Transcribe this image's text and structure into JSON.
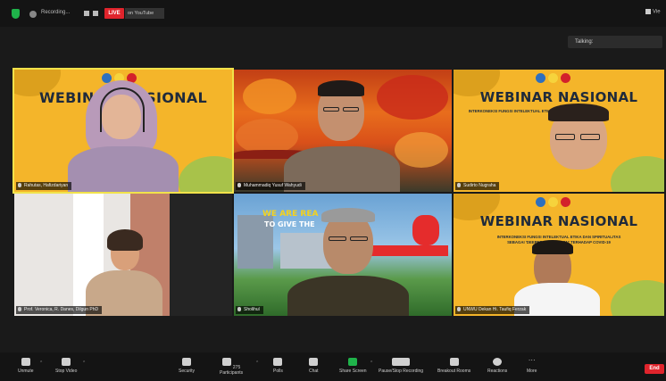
{
  "topbar": {
    "recording_text": "Recording...",
    "live_label": "LIVE",
    "live_destination": "on YouTube",
    "view_label": "Vie"
  },
  "talking_label": "Talking:",
  "banner": {
    "title": "WEBINAR NASIONAL",
    "subtitle_line1": "INTERKONEKSI FUNGSI INTELEKTUAL ETIKA DAN SPIRITUALITAS",
    "subtitle_line2": "SEBAGAI 'DEEPER PROTECTION' TERHADAP COVID-19"
  },
  "participants": [
    {
      "name": "Rahutas, Hafizdariyan"
    },
    {
      "name": "Muhammadiq Yusuf Wahyudi"
    },
    {
      "name": "Sudirto Nugraha"
    },
    {
      "name": "Prof. Veronica, R. Danes, Dilgun PhD"
    },
    {
      "name": "Sholihul"
    },
    {
      "name": "UNWU Dekan Hi. Taufiq Ferzak"
    }
  ],
  "slide_text": {
    "line1": "WE ARE REA",
    "line2": "TO GIVE THE"
  },
  "toolbar": {
    "unmute": "Unmute",
    "stop_video": "Stop Video",
    "security": "Security",
    "participants": "Participants",
    "participants_count": "275",
    "polls": "Polls",
    "chat": "Chat",
    "share_screen": "Share Screen",
    "pause_recording": "Pause/Stop Recording",
    "breakout_rooms": "Breakout Rooms",
    "reactions": "Reactions",
    "more": "More",
    "end": "End"
  },
  "colors": {
    "accent_green": "#1fb34a",
    "live_red": "#e0242c",
    "active_speaker": "#f1e24a",
    "banner_yellow": "#f4b52a"
  }
}
